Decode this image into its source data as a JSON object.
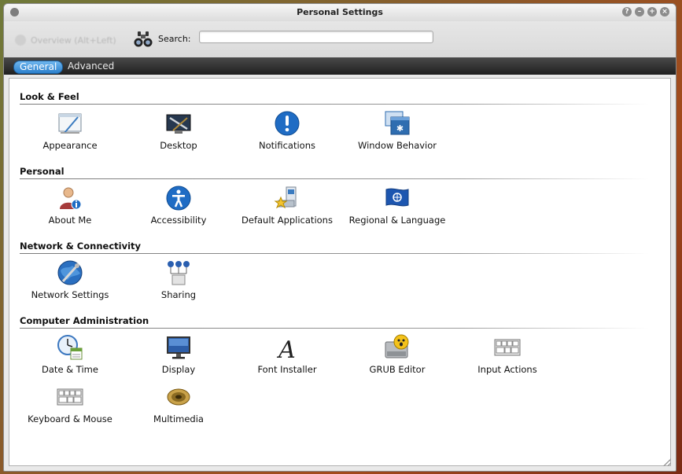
{
  "window": {
    "title": "Personal Settings"
  },
  "toolbar": {
    "overview_label": "Overview (Alt+Left)",
    "search_label": "Search:",
    "search_value": ""
  },
  "tabs": [
    {
      "label": "General",
      "active": true
    },
    {
      "label": "Advanced",
      "active": false
    }
  ],
  "sections": [
    {
      "title": "Look & Feel",
      "items": [
        {
          "label": "Appearance",
          "icon": "appearance-icon"
        },
        {
          "label": "Desktop",
          "icon": "desktop-icon"
        },
        {
          "label": "Notifications",
          "icon": "notifications-icon"
        },
        {
          "label": "Window Behavior",
          "icon": "window-behavior-icon"
        }
      ]
    },
    {
      "title": "Personal",
      "items": [
        {
          "label": "About Me",
          "icon": "about-me-icon"
        },
        {
          "label": "Accessibility",
          "icon": "accessibility-icon"
        },
        {
          "label": "Default Applications",
          "icon": "default-applications-icon"
        },
        {
          "label": "Regional & Language",
          "icon": "regional-language-icon"
        }
      ]
    },
    {
      "title": "Network & Connectivity",
      "items": [
        {
          "label": "Network Settings",
          "icon": "network-settings-icon"
        },
        {
          "label": "Sharing",
          "icon": "sharing-icon"
        }
      ]
    },
    {
      "title": "Computer Administration",
      "items": [
        {
          "label": "Date & Time",
          "icon": "date-time-icon"
        },
        {
          "label": "Display",
          "icon": "display-icon"
        },
        {
          "label": "Font Installer",
          "icon": "font-installer-icon"
        },
        {
          "label": "GRUB Editor",
          "icon": "grub-editor-icon"
        },
        {
          "label": "Input Actions",
          "icon": "input-actions-icon"
        },
        {
          "label": "Keyboard & Mouse",
          "icon": "keyboard-mouse-icon"
        },
        {
          "label": "Multimedia",
          "icon": "multimedia-icon"
        }
      ]
    }
  ],
  "colors": {
    "accent": "#2c80cc",
    "tabbar": "#2a2a2a"
  }
}
